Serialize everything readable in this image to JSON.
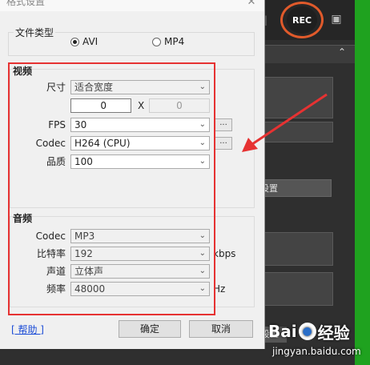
{
  "app": {
    "rec_label": "REC",
    "settings_btn_1": "设置",
    "settings_btn_2": "设置",
    "icons": [
      "camera-icon",
      "chevron-up-icon"
    ]
  },
  "dialog": {
    "title": "格式设置",
    "filetype": {
      "legend": "文件类型",
      "options": [
        {
          "label": "AVI",
          "selected": true
        },
        {
          "label": "MP4",
          "selected": false
        }
      ]
    },
    "video": {
      "title": "视频",
      "size_label": "尺寸",
      "size_value": "适合宽度",
      "width_value": "0",
      "x_label": "X",
      "height_value": "0",
      "fps_label": "FPS",
      "fps_value": "30",
      "codec_label": "Codec",
      "codec_value": "H264 (CPU)",
      "quality_label": "品质",
      "quality_value": "100",
      "more_button": "..."
    },
    "audio": {
      "title": "音频",
      "codec_label": "Codec",
      "codec_value": "MP3",
      "bitrate_label": "比特率",
      "bitrate_value": "192",
      "bitrate_unit": "kbps",
      "channel_label": "声道",
      "channel_value": "立体声",
      "freq_label": "频率",
      "freq_value": "48000",
      "freq_unit": "Hz"
    },
    "help_link": "[ 帮助 ]",
    "ok_button": "确定",
    "cancel_button": "取消"
  },
  "watermark": {
    "logo_left": "Bai",
    "logo_right": "经验",
    "url": "jingyan.baidu.com"
  },
  "colors": {
    "annotation": "#e63232",
    "rec_ring": "#e05a2b",
    "green_strip": "#1fa21f",
    "link": "#1a4bd6"
  }
}
